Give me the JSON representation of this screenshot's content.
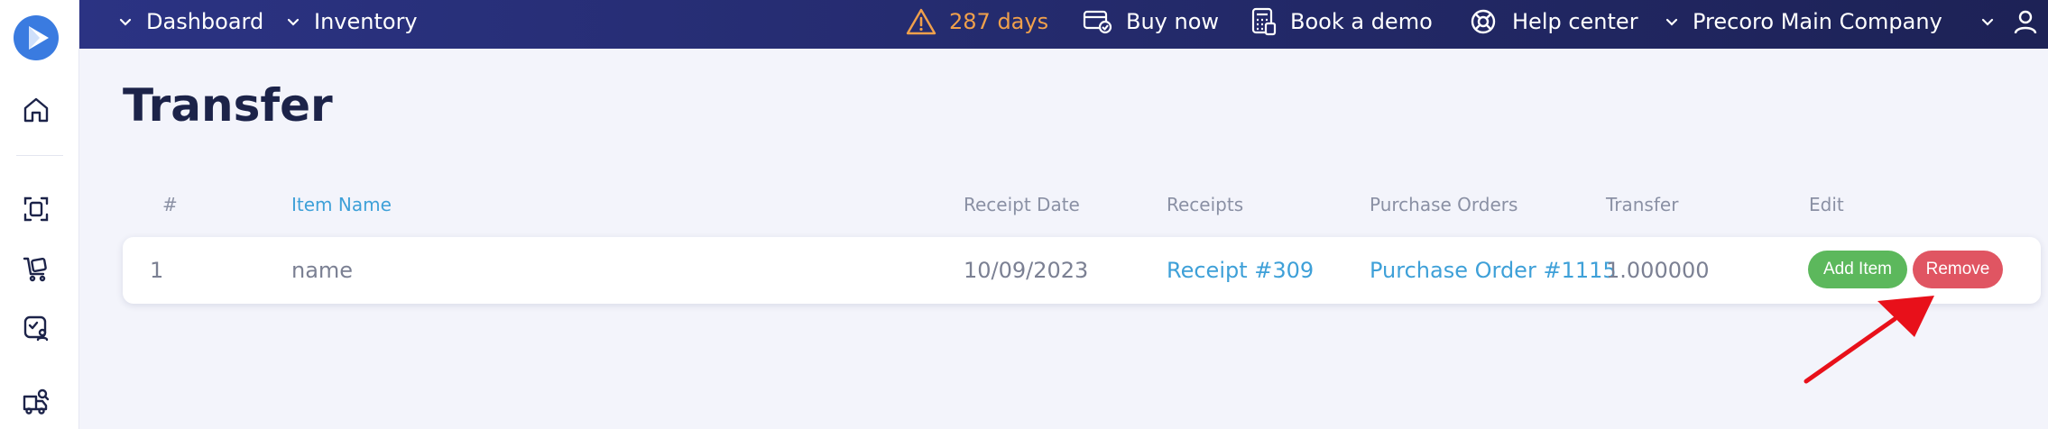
{
  "topbar": {
    "nav": [
      {
        "label": "Dashboard"
      },
      {
        "label": "Inventory"
      }
    ],
    "trial_warning": "287 days",
    "buy_now": "Buy now",
    "book_demo": "Book a demo",
    "help_center": "Help center",
    "company": "Precoro Main Company"
  },
  "page": {
    "title": "Transfer"
  },
  "table": {
    "headers": {
      "num": "#",
      "item_name": "Item Name",
      "receipt_date": "Receipt Date",
      "receipts": "Receipts",
      "purchase_orders": "Purchase Orders",
      "transfer": "Transfer",
      "edit": "Edit"
    },
    "rows": [
      {
        "num": "1",
        "item_name": "name",
        "receipt_date": "10/09/2023",
        "receipt": "Receipt #309",
        "purchase_order": "Purchase Order #1115",
        "transfer": "1.000000",
        "add_label": "Add Item",
        "remove_label": "Remove"
      }
    ]
  },
  "colors": {
    "topbar": "#2b3383",
    "accent_link": "#3ea0d8",
    "warning": "#f0a04b",
    "add_button": "#5cb85c",
    "remove_button": "#e05562",
    "annotation_arrow": "#e8101a"
  },
  "icons": {
    "sidebar": [
      "logo-icon",
      "home-icon",
      "scan-document-icon",
      "cart-icon",
      "approval-icon",
      "truck-search-icon"
    ],
    "topbar": [
      "chevron-down-icon",
      "warning-icon",
      "card-icon",
      "calculator-icon",
      "lifebuoy-icon",
      "user-icon"
    ]
  }
}
